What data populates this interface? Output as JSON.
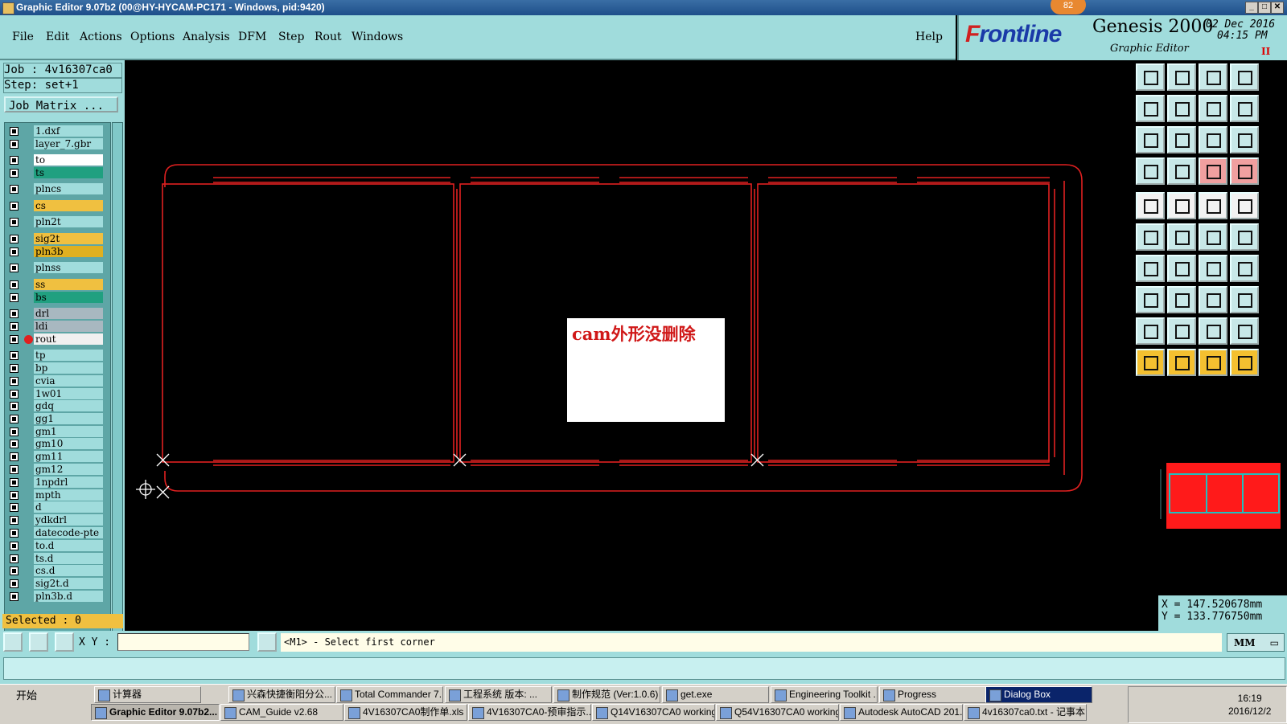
{
  "window": {
    "title": "Graphic Editor 9.07b2 (00@HY-HYCAM-PC171 - Windows, pid:9420)",
    "badge": "82"
  },
  "menu": {
    "items": [
      "File",
      "Edit",
      "Actions",
      "Options",
      "Analysis",
      "DFM",
      "Step",
      "Rout",
      "Windows"
    ],
    "help": "Help"
  },
  "brand": {
    "logo_f": "F",
    "logo_rest": "rontline",
    "product": "Genesis 2000",
    "subtitle": "Graphic Editor",
    "date_line1": "02 Dec 2016",
    "date_line2": "04:15 PM",
    "pause": "II"
  },
  "job": {
    "job": "Job : 4v16307ca0",
    "step": "Step: set+1",
    "matrix_button": "Job Matrix ..."
  },
  "layers": [
    {
      "name": "1.dxf",
      "color": "#a0dcdc"
    },
    {
      "name": "layer_7.gbr",
      "color": "#a0dcdc"
    },
    {
      "name": "to",
      "color": "#ffffff"
    },
    {
      "name": "ts",
      "color": "#20a080"
    },
    {
      "name": "plncs",
      "color": "#a0dcdc"
    },
    {
      "name": "cs",
      "color": "#f0c040"
    },
    {
      "name": "pln2t",
      "color": "#a0dcdc"
    },
    {
      "name": "sig2t",
      "color": "#f0c040"
    },
    {
      "name": "pln3b",
      "color": "#e0b020"
    },
    {
      "name": "plnss",
      "color": "#a0dcdc"
    },
    {
      "name": "ss",
      "color": "#f0c040"
    },
    {
      "name": "bs",
      "color": "#20a080"
    },
    {
      "name": "drl",
      "color": "#a8b8c0"
    },
    {
      "name": "ldi",
      "color": "#a8b8c0"
    },
    {
      "name": "rout",
      "color": "#f0f0f0",
      "active": true
    },
    {
      "name": "tp",
      "color": "#a0dcdc"
    },
    {
      "name": "bp",
      "color": "#a0dcdc"
    },
    {
      "name": "cvia",
      "color": "#a0dcdc"
    },
    {
      "name": "1w01",
      "color": "#a0dcdc"
    },
    {
      "name": "gdq",
      "color": "#a0dcdc"
    },
    {
      "name": "gg1",
      "color": "#a0dcdc"
    },
    {
      "name": "gm1",
      "color": "#a0dcdc"
    },
    {
      "name": "gm10",
      "color": "#a0dcdc"
    },
    {
      "name": "gm11",
      "color": "#a0dcdc"
    },
    {
      "name": "gm12",
      "color": "#a0dcdc"
    },
    {
      "name": "1npdrl",
      "color": "#a0dcdc"
    },
    {
      "name": "mpth",
      "color": "#a0dcdc"
    },
    {
      "name": "d",
      "color": "#a0dcdc"
    },
    {
      "name": "ydkdrl",
      "color": "#a0dcdc"
    },
    {
      "name": "datecode-pte",
      "color": "#a0dcdc"
    },
    {
      "name": "to.d",
      "color": "#a0dcdc"
    },
    {
      "name": "ts.d",
      "color": "#a0dcdc"
    },
    {
      "name": "cs.d",
      "color": "#a0dcdc"
    },
    {
      "name": "sig2t.d",
      "color": "#a0dcdc"
    },
    {
      "name": "pln3b.d",
      "color": "#a0dcdc"
    }
  ],
  "selected": "Selected : 0",
  "canvas": {
    "note": "cam外形没删除",
    "outline_color": "#e02020"
  },
  "coords": {
    "x": "X = 147.520678mm",
    "y": "Y = 133.776750mm"
  },
  "status": {
    "xy_label": "X Y :",
    "xy_value": "",
    "prompt": "<M1> - Select first corner",
    "units": "MM"
  },
  "taskbar": {
    "start": "开始",
    "row1": [
      "计算器",
      "兴森快捷衡阳分公...",
      "Total Commander 7...",
      "工程系统  版本: ...",
      "制作规范 (Ver:1.0.6)",
      "get.exe",
      "Engineering Toolkit ...",
      "Progress",
      "Dialog Box"
    ],
    "row2": [
      "Graphic Editor 9.07b2...",
      "CAM_Guide v2.68",
      "4V16307CA0制作单.xls ...",
      "4V16307CA0-预审指示....",
      "Q14V16307CA0 working...",
      "Q54V16307CA0 working...",
      "Autodesk AutoCAD 201...",
      "4v16307ca0.txt - 记事本"
    ],
    "time": "16:19",
    "date": "2016/12/2"
  }
}
